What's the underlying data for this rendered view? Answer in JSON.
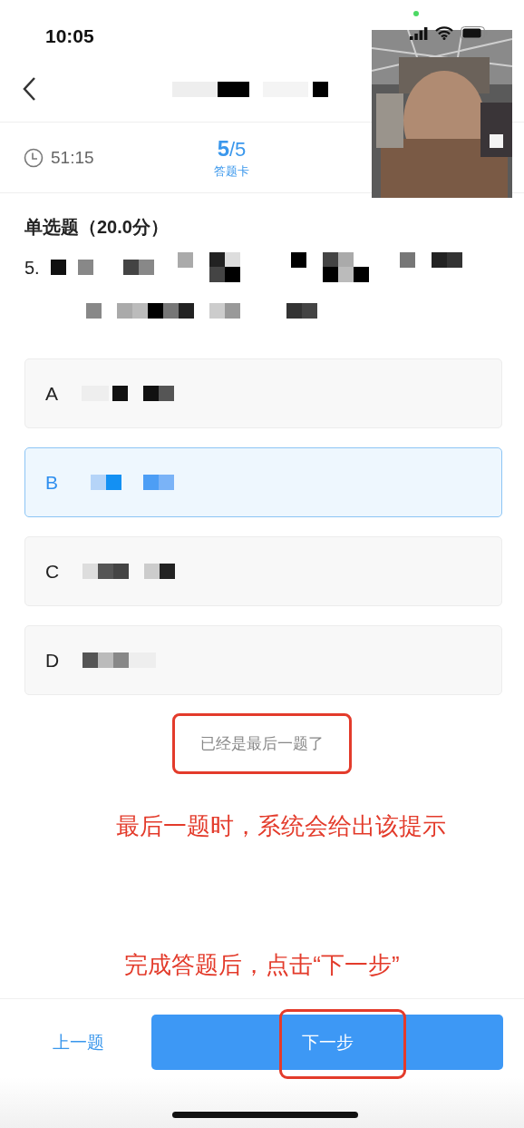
{
  "status_bar": {
    "time": "10:05"
  },
  "timer": {
    "remaining": "51:15"
  },
  "progress": {
    "current": "5",
    "total": "/5",
    "card_label": "答题卡"
  },
  "question": {
    "type_label": "单选题（20.0分）",
    "number": "5."
  },
  "options": [
    {
      "letter": "A",
      "selected": false
    },
    {
      "letter": "B",
      "selected": true
    },
    {
      "letter": "C",
      "selected": false
    },
    {
      "letter": "D",
      "selected": false
    }
  ],
  "hint": {
    "text": "已经是最后一题了",
    "highlighted": true
  },
  "annotations": [
    {
      "kind": "note",
      "text": "最后一题时，系统会给出该提示"
    },
    {
      "kind": "note",
      "text": "完成答题后，点击“下一步”"
    }
  ],
  "footer": {
    "prev": "上一题",
    "next": "下一步",
    "next_highlighted": true
  }
}
